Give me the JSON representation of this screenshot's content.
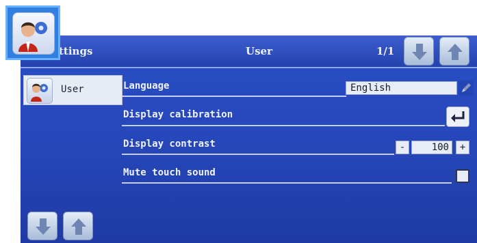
{
  "header": {
    "title_left": "ttings",
    "title_center": "User",
    "page_indicator": "1/1"
  },
  "icons": {
    "app": "user-settings-icon",
    "sidebar_user": "user-settings-icon",
    "scroll_down": "arrow-down-icon",
    "scroll_up": "arrow-up-icon",
    "edit": "pencil-icon",
    "enter": "enter-return-icon"
  },
  "sidebar": {
    "items": [
      {
        "label": "User",
        "selected": true
      }
    ]
  },
  "settings": {
    "language": {
      "label": "Language",
      "value": "English"
    },
    "calibration": {
      "label": "Display calibration"
    },
    "contrast": {
      "label": "Display contrast",
      "value": "100",
      "minus": "-",
      "plus": "+"
    },
    "mute": {
      "label": "Mute touch sound",
      "checked": false
    }
  },
  "colors": {
    "background": "#2646b8",
    "titlebar": "#2d4cc0",
    "text": "#f1f4ff",
    "field": "#e8ecf4",
    "app_icon_frame": "#2f7fe0"
  }
}
